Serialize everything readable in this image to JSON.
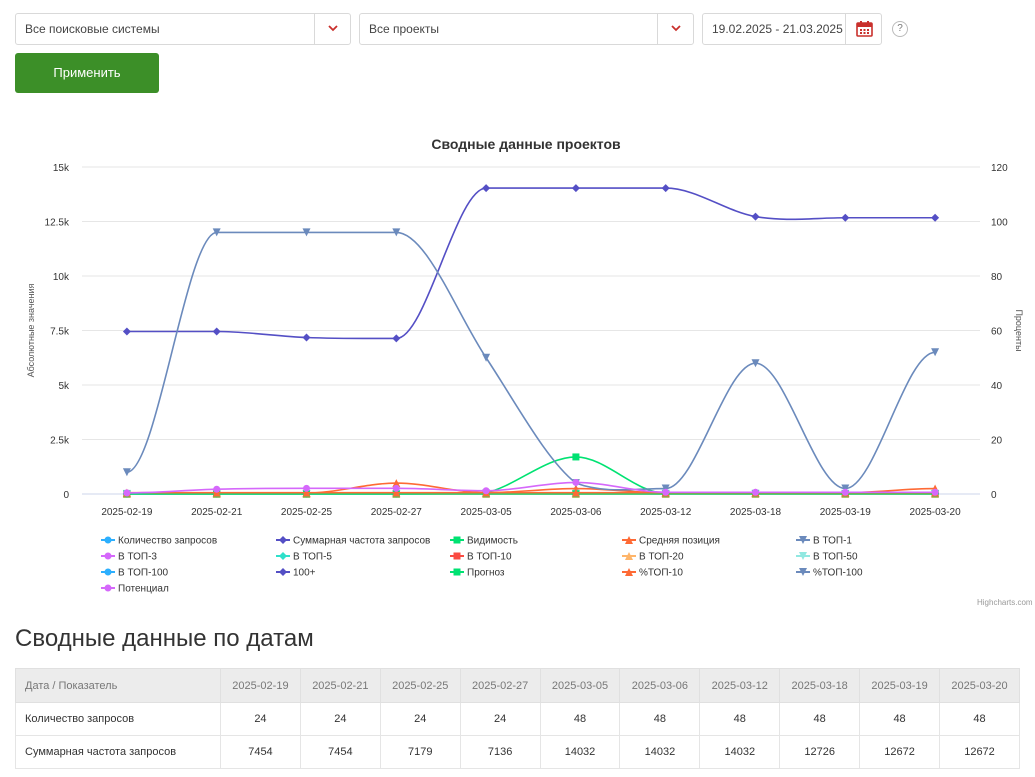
{
  "filters": {
    "search_engine": "Все поисковые системы",
    "project": "Все проекты",
    "date_range": "19.02.2025 - 21.03.2025",
    "help": "?"
  },
  "apply_label": "Применить",
  "chart_data": {
    "type": "line",
    "title": "Сводные данные проектов",
    "ylabel_left": "Абсолютные значения",
    "ylabel_right": "Проценты",
    "ylim_left": [
      0,
      15000
    ],
    "ylim_right": [
      0,
      120
    ],
    "yticks_left": [
      "0",
      "2.5k",
      "5k",
      "7.5k",
      "10k",
      "12.5k",
      "15k"
    ],
    "yticks_right": [
      "0",
      "20",
      "40",
      "60",
      "80",
      "100",
      "120"
    ],
    "categories": [
      "2025-02-19",
      "2025-02-21",
      "2025-02-25",
      "2025-02-27",
      "2025-03-05",
      "2025-03-06",
      "2025-03-12",
      "2025-03-18",
      "2025-03-19",
      "2025-03-20"
    ],
    "series": [
      {
        "name": "Количество запросов",
        "color": "#2caffe",
        "marker": "circle",
        "axis": "left",
        "values": [
          24,
          24,
          24,
          24,
          48,
          48,
          48,
          48,
          48,
          48
        ]
      },
      {
        "name": "Суммарная частота запросов",
        "color": "#544fc5",
        "marker": "diamond",
        "axis": "left",
        "values": [
          7454,
          7454,
          7179,
          7136,
          14032,
          14032,
          14032,
          12726,
          12672,
          12672
        ]
      },
      {
        "name": "Видимость",
        "color": "#00e272",
        "marker": "square",
        "axis": "left",
        "values": [
          10,
          10,
          10,
          10,
          60,
          1700,
          30,
          30,
          20,
          20
        ]
      },
      {
        "name": "Средняя позиция",
        "color": "#fe6a35",
        "marker": "triangle",
        "axis": "left",
        "values": [
          40,
          40,
          40,
          500,
          60,
          250,
          50,
          60,
          60,
          250
        ]
      },
      {
        "name": "В ТОП-1",
        "color": "#6b8abc",
        "marker": "triangle-down",
        "axis": "left",
        "values": [
          0,
          0,
          0,
          0,
          0,
          0,
          0,
          0,
          0,
          0
        ]
      },
      {
        "name": "В ТОП-3",
        "color": "#d568fb",
        "marker": "circle",
        "axis": "left",
        "values": [
          0,
          0,
          0,
          0,
          0,
          0,
          0,
          0,
          0,
          0
        ]
      },
      {
        "name": "В ТОП-5",
        "color": "#2ee0ca",
        "marker": "diamond",
        "axis": "left",
        "values": [
          0,
          0,
          0,
          0,
          0,
          0,
          0,
          0,
          0,
          0
        ]
      },
      {
        "name": "В ТОП-10",
        "color": "#fa4b42",
        "marker": "square",
        "axis": "left",
        "values": [
          1,
          1,
          1,
          1,
          1,
          1,
          1,
          1,
          1,
          1
        ]
      },
      {
        "name": "В ТОП-20",
        "color": "#feb56a",
        "marker": "triangle",
        "axis": "left",
        "values": [
          2,
          2,
          2,
          2,
          2,
          2,
          2,
          2,
          2,
          2
        ]
      },
      {
        "name": "В ТОП-50",
        "color": "#91e8e1",
        "marker": "triangle-down",
        "axis": "left",
        "values": [
          5,
          5,
          5,
          5,
          10,
          10,
          10,
          10,
          10,
          10
        ]
      },
      {
        "name": "В ТОП-100",
        "color": "#2caffe",
        "marker": "circle",
        "axis": "left",
        "values": [
          8,
          8,
          8,
          8,
          15,
          15,
          15,
          15,
          15,
          15
        ]
      },
      {
        "name": "100+",
        "color": "#544fc5",
        "marker": "diamond",
        "axis": "left",
        "values": [
          16,
          16,
          16,
          16,
          33,
          33,
          33,
          33,
          33,
          33
        ]
      },
      {
        "name": "Прогноз",
        "color": "#00e272",
        "marker": "square",
        "axis": "left",
        "values": [
          5,
          5,
          5,
          5,
          10,
          10,
          10,
          10,
          10,
          10
        ]
      },
      {
        "name": "%ТОП-10",
        "color": "#fe6a35",
        "marker": "triangle",
        "axis": "right",
        "values": [
          0.5,
          0.5,
          0.5,
          0.5,
          0.5,
          0.5,
          0.5,
          0.5,
          0.5,
          0.5
        ]
      },
      {
        "name": "%ТОП-100",
        "color": "#6b8abc",
        "marker": "triangle-down",
        "axis": "right",
        "values": [
          8,
          96,
          96,
          96,
          50,
          4,
          2,
          48,
          2,
          52
        ]
      },
      {
        "name": "Потенциал",
        "color": "#d568fb",
        "marker": "circle",
        "axis": "left",
        "values": [
          50,
          220,
          260,
          260,
          150,
          530,
          80,
          80,
          80,
          80
        ]
      }
    ]
  },
  "credits": "Highcharts.com",
  "dates_section": {
    "title": "Сводные данные по датам",
    "header_first": "Дата / Показатель",
    "dates": [
      "2025-02-19",
      "2025-02-21",
      "2025-02-25",
      "2025-02-27",
      "2025-03-05",
      "2025-03-06",
      "2025-03-12",
      "2025-03-18",
      "2025-03-19",
      "2025-03-20"
    ],
    "rows": [
      {
        "label": "Количество запросов",
        "values": [
          "24",
          "24",
          "24",
          "24",
          "48",
          "48",
          "48",
          "48",
          "48",
          "48"
        ]
      },
      {
        "label": "Суммарная частота запросов",
        "values": [
          "7454",
          "7454",
          "7179",
          "7136",
          "14032",
          "14032",
          "14032",
          "12726",
          "12672",
          "12672"
        ]
      }
    ]
  }
}
